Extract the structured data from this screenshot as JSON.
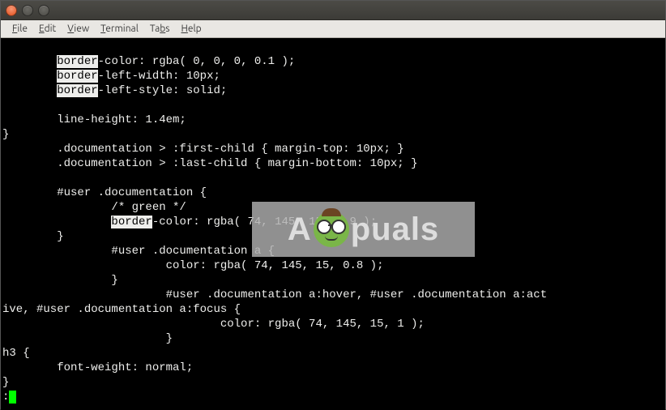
{
  "menubar": {
    "file": "File",
    "edit": "Edit",
    "view": "View",
    "terminal": "Terminal",
    "tabs": "Tabs",
    "help": "Help"
  },
  "watermark": {
    "prefix": "A",
    "suffix": "puals"
  },
  "code": {
    "highlight_word": "border",
    "l1_rest": "-color: rgba( 0, 0, 0, 0.1 );",
    "l2_rest": "-left-width: 10px;",
    "l3_rest": "-left-style: solid;",
    "l4": "",
    "l5": "        line-height: 1.4em;",
    "l6": "}",
    "l7": "        .documentation > :first-child { margin-top: 10px; }",
    "l8": "        .documentation > :last-child { margin-bottom: 10px; }",
    "l9": "",
    "l10": "        #user .documentation {",
    "l11": "                /* green */",
    "l12_pad": "                ",
    "l12_rest": "-color: rgba( 74, 145, 15, 0.9 );",
    "l13": "        }",
    "l14": "                #user .documentation a {",
    "l15": "                        color: rgba( 74, 145, 15, 0.8 );",
    "l16": "                }",
    "l17": "                        #user .documentation a:hover, #user .documentation a:act",
    "l18": "ive, #user .documentation a:focus {",
    "l19": "                                color: rgba( 74, 145, 15, 1 );",
    "l20": "                        }",
    "l21": "h3 {",
    "l22": "        font-weight: normal;",
    "l23": "}",
    "prompt": ":"
  }
}
